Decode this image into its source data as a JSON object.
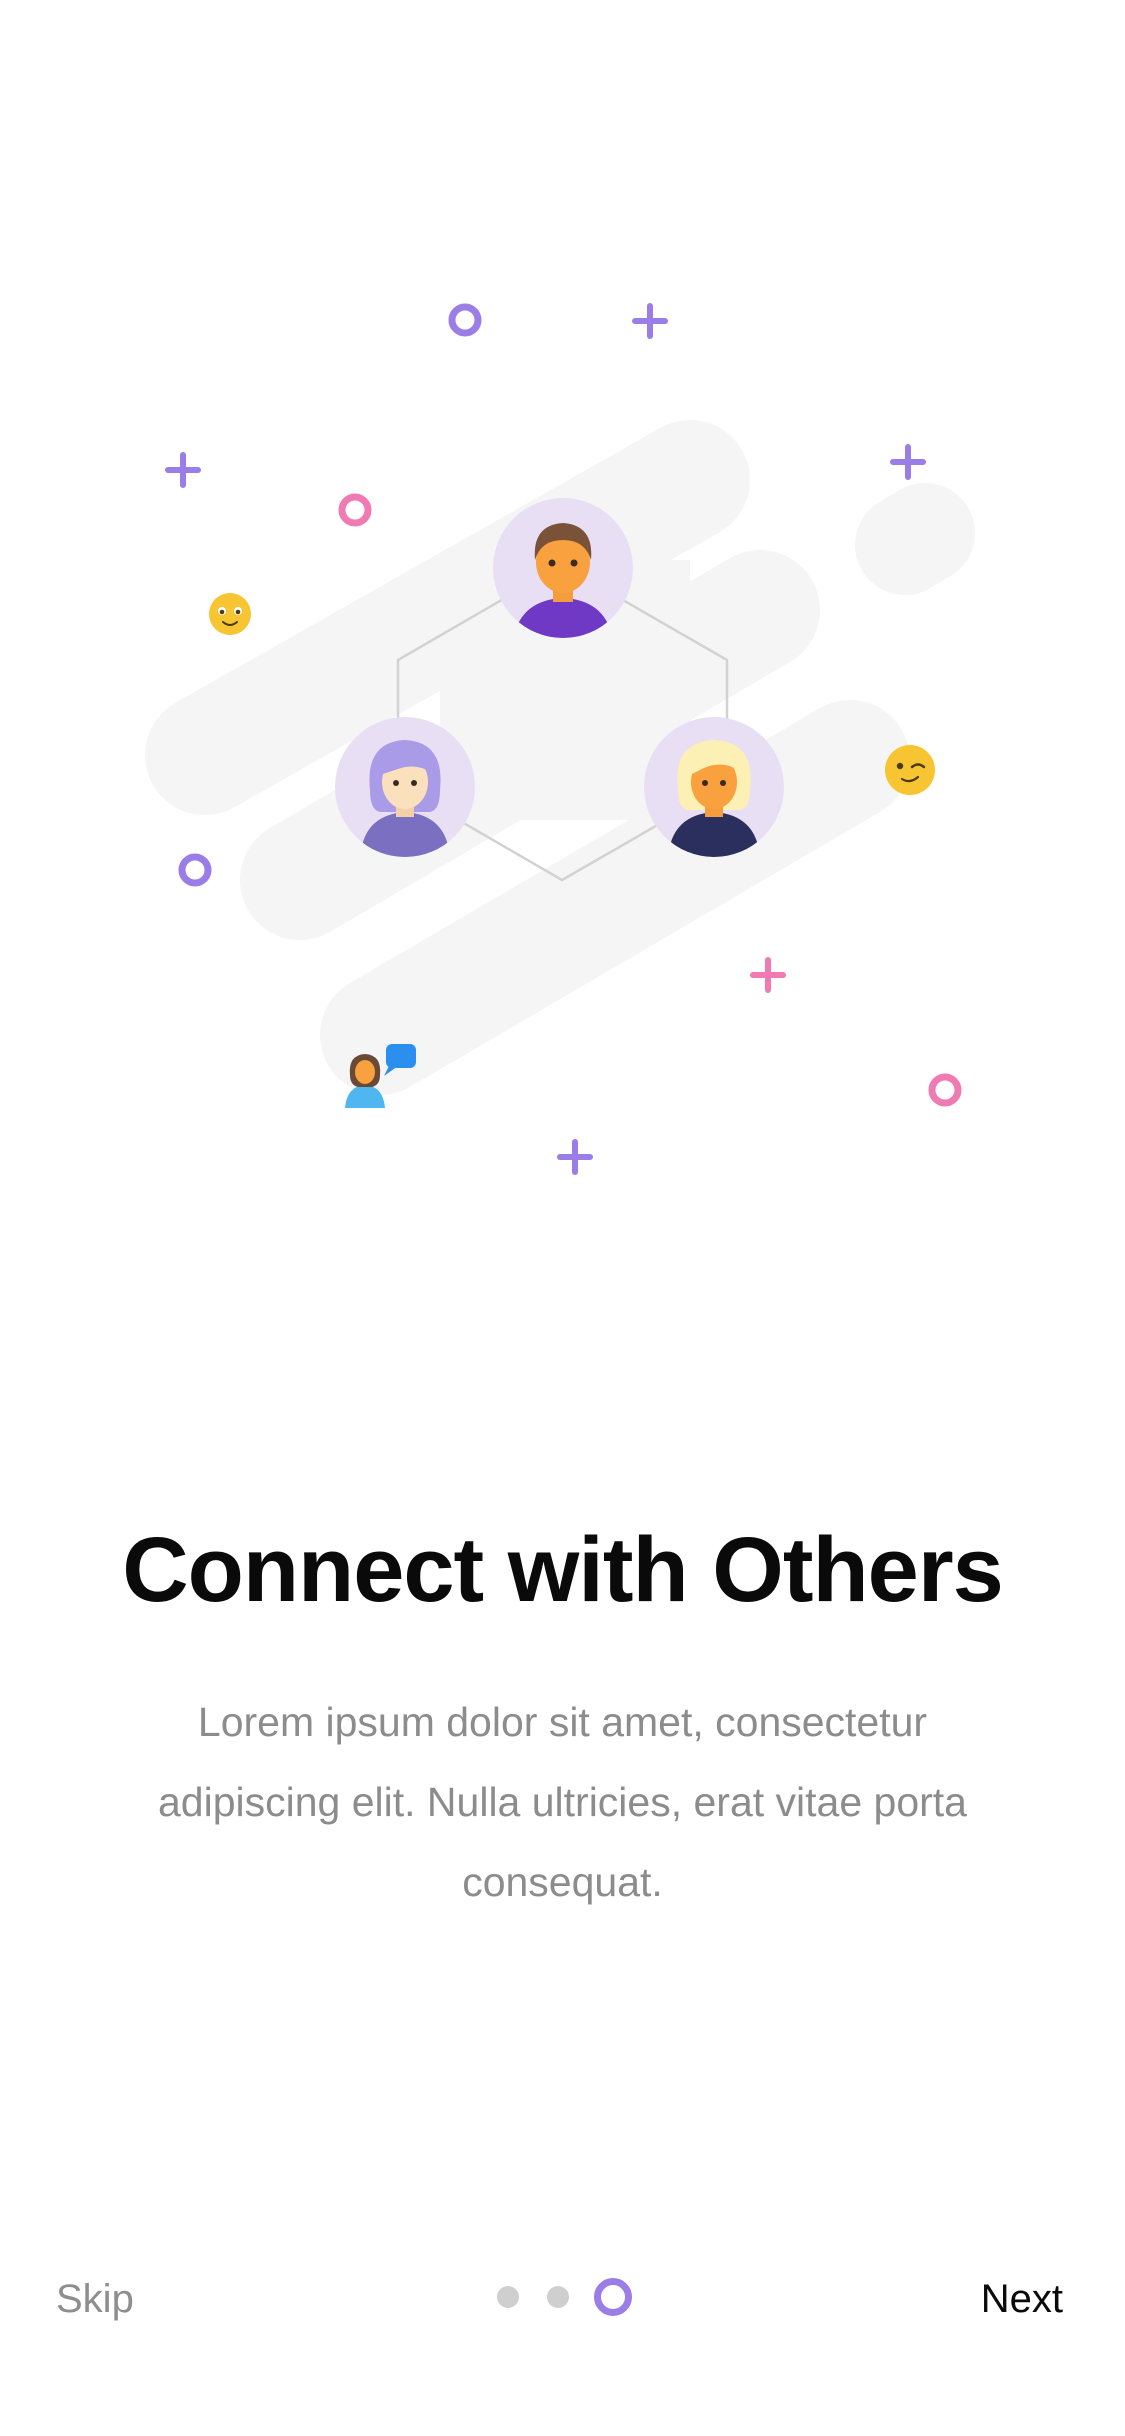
{
  "onboarding": {
    "title": "Connect with Others",
    "description": "Lorem ipsum dolor sit amet, consectetur adipiscing elit. Nulla ultricies, erat vitae porta consequat.",
    "skip_label": "Skip",
    "next_label": "Next",
    "page_indicator": {
      "total_pages": 3,
      "current_page": 3
    }
  },
  "colors": {
    "accent": "#9b7de8",
    "pink": "#f07ab2",
    "emoji_yellow": "#f7c531",
    "blob_gray": "#f5f5f5",
    "text_muted": "#8c8c8c",
    "dot_inactive": "#cfcfcf"
  },
  "illustration": {
    "icons": [
      "person-avatar-icon",
      "emoji-smile-icon",
      "emoji-wink-icon",
      "chat-person-icon",
      "sparkle-icon",
      "ring-icon"
    ]
  }
}
